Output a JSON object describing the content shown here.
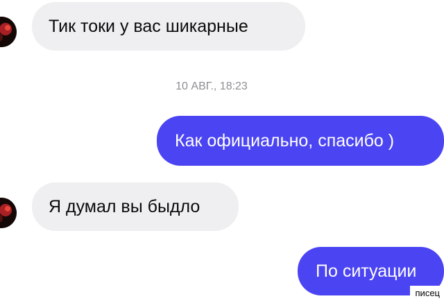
{
  "messages": [
    {
      "side": "incoming",
      "text": "Тик токи у вас шикарные"
    },
    {
      "side": "timestamp",
      "text": "10 АВГ., 18:23"
    },
    {
      "side": "outgoing",
      "text": "Как официально, спасибо )"
    },
    {
      "side": "incoming",
      "text": "Я думал вы быдло"
    },
    {
      "side": "outgoing",
      "text": "По ситуации"
    }
  ],
  "watermark": "писец",
  "colors": {
    "incoming_bubble": "#efeff1",
    "outgoing_bubble": "#4b44f2",
    "timestamp_text": "#8e8e93"
  },
  "icons": {
    "avatar": "avatar-icon"
  }
}
